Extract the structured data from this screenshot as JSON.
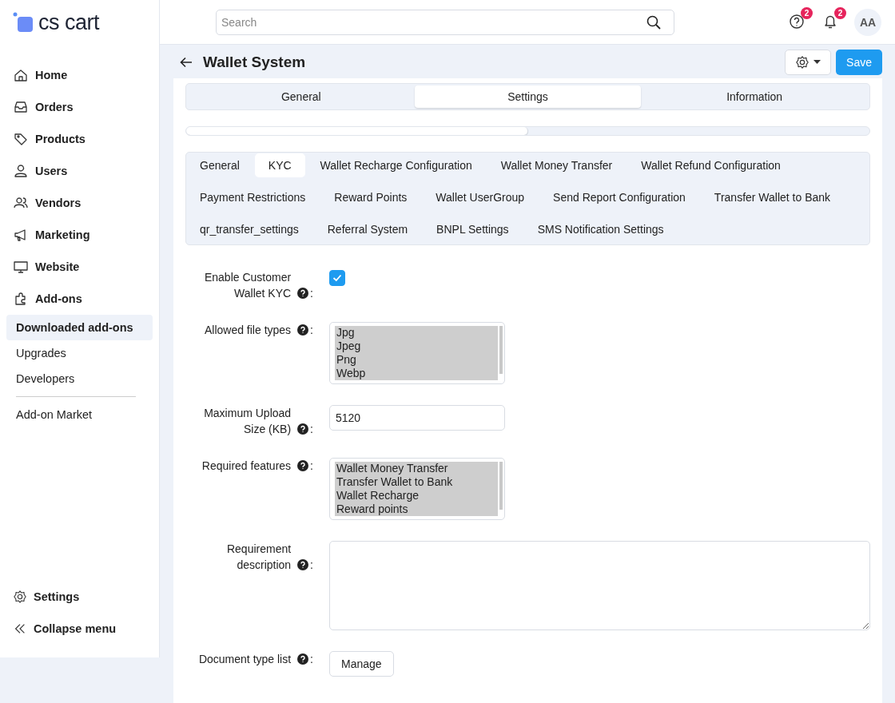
{
  "brand": {
    "name": "cs cart"
  },
  "sidebar": {
    "items": [
      {
        "label": "Home",
        "selected": false
      },
      {
        "label": "Orders",
        "selected": false
      },
      {
        "label": "Products",
        "selected": false
      },
      {
        "label": "Users",
        "selected": false
      },
      {
        "label": "Vendors",
        "selected": false
      },
      {
        "label": "Marketing",
        "selected": false
      },
      {
        "label": "Website",
        "selected": false
      },
      {
        "label": "Add-ons",
        "selected": false
      }
    ],
    "subitems": [
      {
        "label": "Downloaded add-ons",
        "selected": true
      },
      {
        "label": "Upgrades",
        "selected": false
      },
      {
        "label": "Developers",
        "selected": false
      }
    ],
    "extra_items": [
      {
        "label": "Add-on Market",
        "selected": false
      }
    ],
    "footer_items": [
      {
        "label": "Settings"
      },
      {
        "label": "Collapse menu"
      }
    ]
  },
  "header": {
    "search": {
      "placeholder": "Search"
    },
    "help_badge": "2",
    "notifications_badge": "2",
    "avatar": "AA"
  },
  "page": {
    "title": "Wallet System",
    "save_button": "Save"
  },
  "tabs": [
    {
      "label": "General",
      "selected": false
    },
    {
      "label": "Settings",
      "selected": true
    },
    {
      "label": "Information",
      "selected": false
    }
  ],
  "progress": {
    "level": 0.5
  },
  "section_tabs": [
    {
      "label": "General",
      "selected": false
    },
    {
      "label": "KYC",
      "selected": true
    },
    {
      "label": "Wallet Recharge Configuration",
      "selected": false
    },
    {
      "label": "Wallet Money Transfer",
      "selected": false
    },
    {
      "label": "Wallet Refund Configuration",
      "selected": false
    },
    {
      "label": "Payment Restrictions",
      "selected": false
    },
    {
      "label": "Reward Points",
      "selected": false
    },
    {
      "label": "Wallet UserGroup",
      "selected": false
    },
    {
      "label": "Send Report Configuration",
      "selected": false
    },
    {
      "label": "Transfer Wallet to Bank",
      "selected": false
    },
    {
      "label": "qr_transfer_settings",
      "selected": false
    },
    {
      "label": "Referral System",
      "selected": false
    },
    {
      "label": "BNPL Settings",
      "selected": false
    },
    {
      "label": "SMS Notification Settings",
      "selected": false
    }
  ],
  "fields": [
    {
      "kind": "checkbox",
      "label": "Enable Customer Wallet KYC",
      "colon": ":",
      "checked": true
    },
    {
      "kind": "multiselect",
      "label": "Allowed file types",
      "colon": ":",
      "options": [
        {
          "label": "Jpg",
          "selected": true
        },
        {
          "label": "Jpeg",
          "selected": true
        },
        {
          "label": "Png",
          "selected": true
        },
        {
          "label": "Webp",
          "selected": true
        }
      ]
    },
    {
      "kind": "text",
      "label": "Maximum Upload Size (KB)",
      "colon": ":",
      "value": "5120"
    },
    {
      "kind": "multiselect",
      "label": "Required features",
      "colon": ":",
      "options": [
        {
          "label": "Wallet Money Transfer",
          "selected": true
        },
        {
          "label": "Transfer Wallet to Bank",
          "selected": true
        },
        {
          "label": "Wallet Recharge",
          "selected": true
        },
        {
          "label": "Reward points",
          "selected": true
        }
      ]
    },
    {
      "kind": "textarea",
      "label": "Requirement description",
      "colon": ":"
    },
    {
      "kind": "button",
      "label": "Document type list",
      "colon": ":",
      "button": "Manage"
    }
  ]
}
